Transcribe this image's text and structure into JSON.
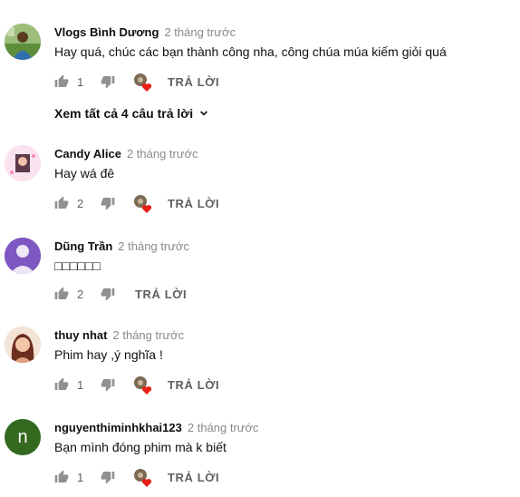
{
  "comments": [
    {
      "author": "Vlogs Bình Dương",
      "time": "2 tháng trước",
      "text": "Hay quá, chúc các bạn thành công nha, công chúa múa kiếm giỏi quá",
      "likes": "1",
      "reply_label": "TRẢ LỜI",
      "avatar_icon": "photo-avatar",
      "has_creator_heart": true
    },
    {
      "author": "Candy Alice",
      "time": "2 tháng trước",
      "text": "Hay wá đê",
      "likes": "2",
      "reply_label": "TRẢ LỜI",
      "avatar_icon": "photo-avatar",
      "has_creator_heart": true
    },
    {
      "author": "Dũng Trần",
      "time": "2 tháng trước",
      "text": "□□□□□□",
      "likes": "2",
      "reply_label": "TRẢ LỜI",
      "avatar_icon": "default-person-avatar",
      "has_creator_heart": false
    },
    {
      "author": "thuy nhat",
      "time": "2 tháng trước",
      "text": "Phim hay ,ý nghĩa !",
      "likes": "1",
      "reply_label": "TRẢ LỜI",
      "avatar_icon": "photo-avatar",
      "has_creator_heart": true
    },
    {
      "author": "nguyenthiminhkhai123",
      "time": "2 tháng trước",
      "text": "Bạn mình đóng phim mà k biết",
      "likes": "1",
      "reply_label": "TRẢ LỜI",
      "avatar_icon": "letter-avatar",
      "avatar_letter": "n",
      "has_creator_heart": true
    }
  ],
  "view_replies_label": "Xem tất cả 4 câu trả lời",
  "colors": {
    "heart": "#e62117",
    "letter_avatar_bg": "#33691e",
    "default_avatar_bg": "#7e57c2",
    "icon_gray": "#909090"
  }
}
